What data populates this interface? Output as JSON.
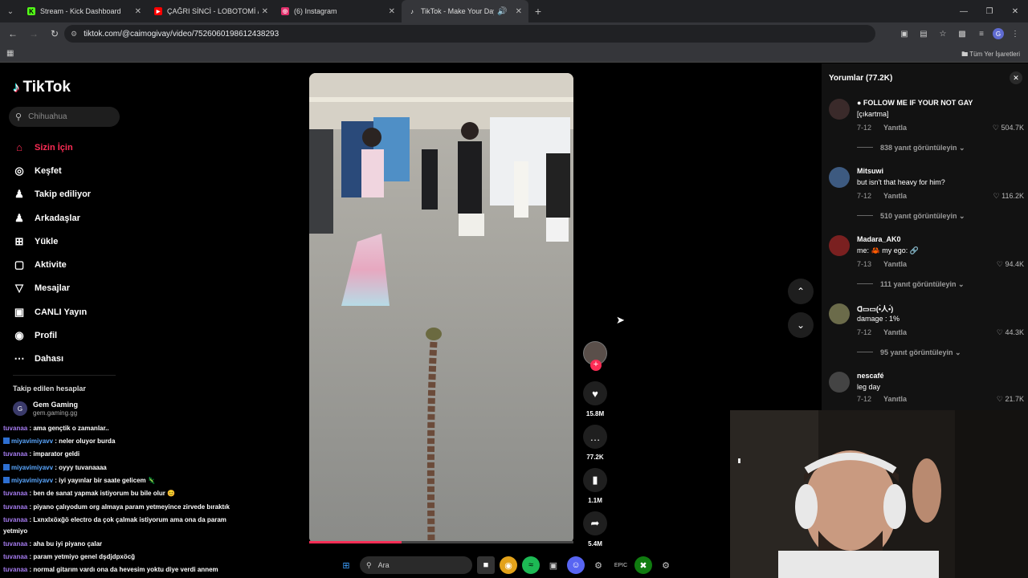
{
  "browser": {
    "tabs": [
      {
        "title": "Stream - Kick Dashboard",
        "favicon": "K",
        "color": "#53fc18"
      },
      {
        "title": "ÇAĞRI SİNCİ - LOBOTOMİ / ROI",
        "favicon": "▶",
        "color": "#ff0000"
      },
      {
        "title": "(6) Instagram",
        "favicon": "◎",
        "color": "#e1306c"
      },
      {
        "title": "TikTok - Make Your Day",
        "favicon": "♪",
        "color": "#ffffff"
      }
    ],
    "url": "tiktok.com/@caimogivay/video/7526060198612438293",
    "all_bookmarks": "Tüm Yer İşaretleri",
    "profile_letter": "G"
  },
  "sidebar": {
    "brand": "TikTok",
    "search_placeholder": "Chihuahua",
    "nav": [
      {
        "label": "Sizin İçin",
        "icon": "home-icon",
        "glyph": "⌂"
      },
      {
        "label": "Keşfet",
        "icon": "compass-icon",
        "glyph": "◎"
      },
      {
        "label": "Takip ediliyor",
        "icon": "following-icon",
        "glyph": "♟"
      },
      {
        "label": "Arkadaşlar",
        "icon": "friends-icon",
        "glyph": "♟"
      },
      {
        "label": "Yükle",
        "icon": "upload-icon",
        "glyph": "⊞"
      },
      {
        "label": "Aktivite",
        "icon": "activity-icon",
        "glyph": "▢"
      },
      {
        "label": "Mesajlar",
        "icon": "messages-icon",
        "glyph": "▽"
      },
      {
        "label": "CANLI Yayın",
        "icon": "live-icon",
        "glyph": "▣"
      },
      {
        "label": "Profil",
        "icon": "profile-icon",
        "glyph": "◉"
      },
      {
        "label": "Dahası",
        "icon": "more-icon",
        "glyph": "…"
      }
    ],
    "following_header": "Takip edilen hesaplar",
    "following_account": {
      "name": "Gem Gaming",
      "handle": "gem.gaming.gg"
    }
  },
  "chat": [
    {
      "user": "tuvanaa",
      "msg": "ama gençtik o zamanlar..",
      "badge": false
    },
    {
      "user": "miyavimiyavv",
      "msg": "neler oluyor burda",
      "badge": true
    },
    {
      "user": "tuvanaa",
      "msg": "imparator geldi",
      "badge": false
    },
    {
      "user": "miyavimiyavv",
      "msg": "oyyy tuvanaaaa",
      "badge": true
    },
    {
      "user": "miyavimiyavv",
      "msg": "iyi yayınlar bir saate gelicem 🦎",
      "badge": true
    },
    {
      "user": "tuvanaa",
      "msg": "ben de sanat yapmak istiyorum bu bile olur 😊",
      "badge": false
    },
    {
      "user": "tuvanaa",
      "msg": "piyano çalıyodum org almaya param yetmeyince zirvede bıraktık",
      "badge": false
    },
    {
      "user": "tuvanaa",
      "msg": "Lxnxlxöxğö electro da çok çalmak istiyorum ama ona da param yetmiyo",
      "badge": false
    },
    {
      "user": "tuvanaa",
      "msg": "aha bu iyi piyano çalar",
      "badge": false
    },
    {
      "user": "tuvanaa",
      "msg": "param yetmiyo genel dşdjdpxöcğ",
      "badge": false
    },
    {
      "user": "tuvanaa",
      "msg": "normal gitarım vardı ona da hevesim yoktu diye verdi annem",
      "badge": false
    }
  ],
  "video": {
    "progress": 0.35,
    "likes": "15.8M",
    "comments": "77.2K",
    "saves": "1.1M",
    "shares": "5.4M"
  },
  "comments_panel": {
    "title": "Yorumlar (77.2K)",
    "reply_label": "Yanıtla",
    "items": [
      {
        "user": "● FOLLOW ME IF YOUR NOT GAY",
        "text": "[çıkartma]",
        "date": "7-12",
        "likes": "504.7K",
        "more": "838 yanıt görüntüleyin",
        "color": "#3a2a2a"
      },
      {
        "user": "Mitsuwi",
        "text": "but isn't that heavy for him?",
        "date": "7-12",
        "likes": "116.2K",
        "more": "510 yanıt görüntüleyin",
        "color": "#3d5a80"
      },
      {
        "user": "Madara_AK0",
        "text": "me: 🦀 my ego: 🔗",
        "date": "7-13",
        "likes": "94.4K",
        "more": "111 yanıt görüntüleyin",
        "color": "#7a2020"
      },
      {
        "user": "ᗡ▭▭(•̀人•́)",
        "text": "damage : 1%",
        "date": "7-12",
        "likes": "44.3K",
        "more": "95 yanıt görüntüleyin",
        "color": "#6b6b4a"
      },
      {
        "user": "nescafé",
        "text": "leg day",
        "date": "7-12",
        "likes": "21.7K",
        "more": "",
        "color": "#444444"
      }
    ]
  },
  "taskbar": {
    "search_label": "Ara"
  },
  "colors": {
    "accent": "#fe2c55",
    "background": "#000000",
    "panel": "#121212"
  }
}
